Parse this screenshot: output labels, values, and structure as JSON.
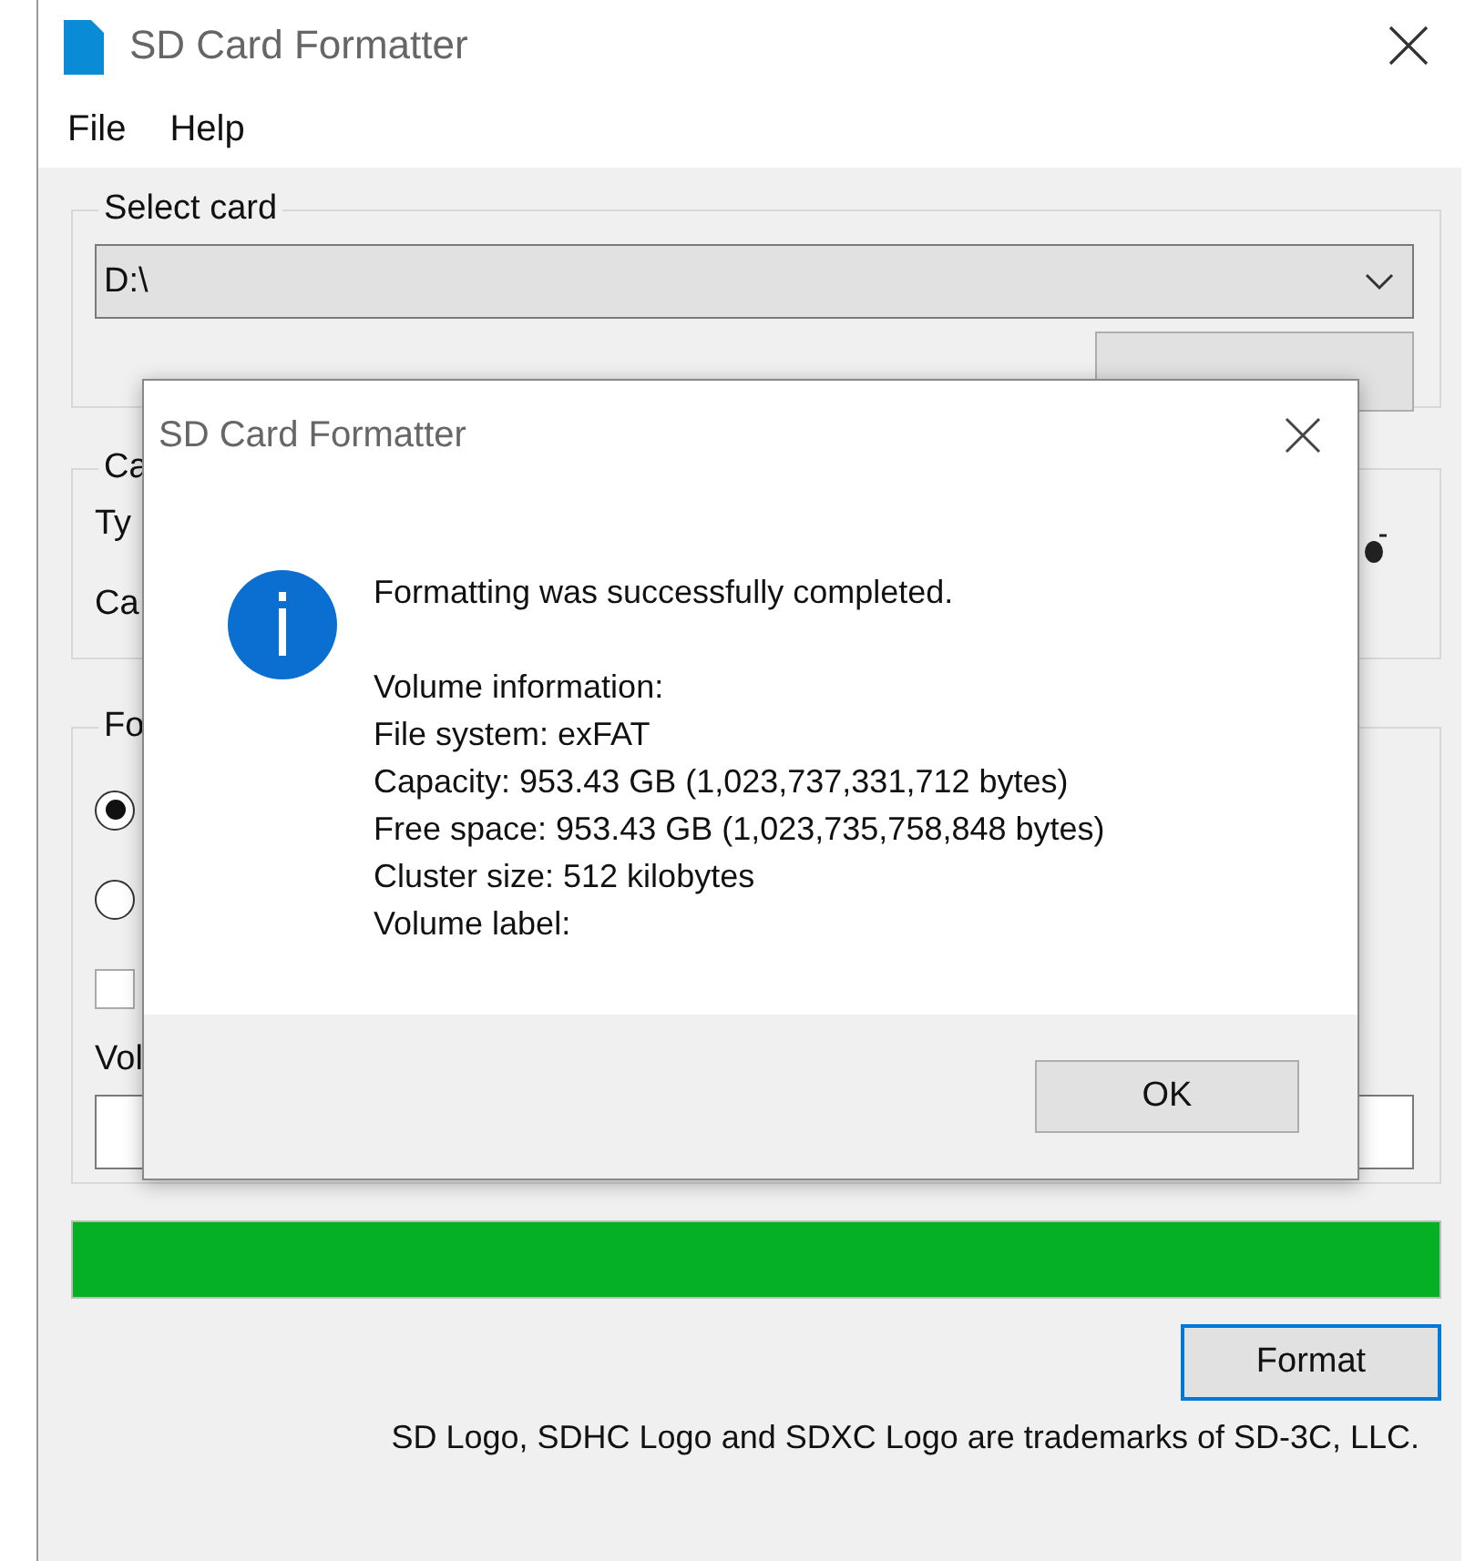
{
  "window": {
    "title": "SD Card Formatter",
    "menu": [
      "File",
      "Help"
    ]
  },
  "select_card": {
    "label": "Select card",
    "drive": "D:\\"
  },
  "card_information": {
    "label": "Ca",
    "rows": [
      "Ty",
      "Ca"
    ]
  },
  "format_options": {
    "label": "Fo",
    "options": [
      {
        "kind": "radio",
        "selected": true
      },
      {
        "kind": "radio",
        "selected": false
      },
      {
        "kind": "checkbox",
        "checked": false
      }
    ],
    "volume_label": "Vol"
  },
  "progress": {
    "level": 1
  },
  "format_button": "Format",
  "trademark": "SD Logo, SDHC Logo and SDXC Logo are trademarks of SD-3C, LLC.",
  "dialog": {
    "title": "SD Card Formatter",
    "kind": "info",
    "message": "Formatting was successfully completed.",
    "details": [
      "Volume information:",
      "File system: exFAT",
      "Capacity: 953.43 GB (1,023,737,331,712 bytes)",
      "Free space: 953.43 GB (1,023,735,758,848 bytes)",
      "Cluster size: 512 kilobytes",
      "Volume label:"
    ],
    "buttons": [
      "OK"
    ]
  }
}
